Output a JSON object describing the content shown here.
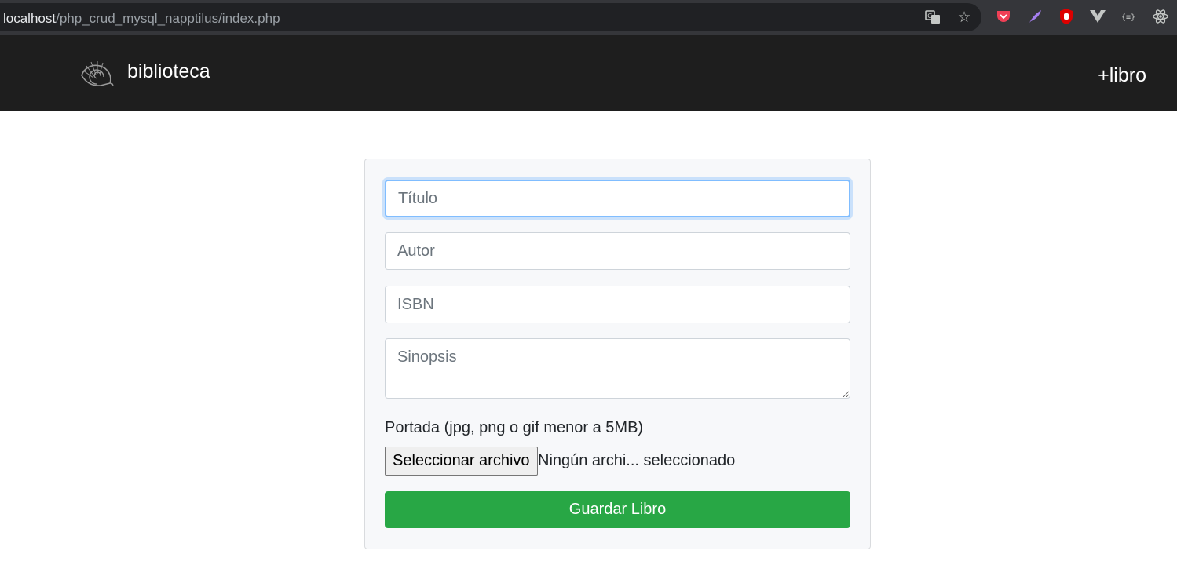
{
  "browser": {
    "url_host": "localhost",
    "url_path": "/php_crud_mysql_napptilus/index.php",
    "icons": [
      "translate-icon",
      "bookmark-star-icon",
      "pocket-extension-icon",
      "feather-extension-icon",
      "ublock-extension-icon",
      "vue-devtools-icon",
      "json-extension-icon",
      "react-devtools-icon"
    ]
  },
  "navbar": {
    "brand": "biblioteca",
    "add_link": "+libro",
    "background": "#1e1e1e"
  },
  "form": {
    "title_placeholder": "Título",
    "author_placeholder": "Autor",
    "isbn_placeholder": "ISBN",
    "synopsis_placeholder": "Sinopsis",
    "cover_label": "Portada (jpg, png o gif menor a 5MB)",
    "file_button": "Seleccionar archivo",
    "file_status": "Ningún archi... seleccionado",
    "submit_label": "Guardar Libro",
    "submit_color": "#28a745"
  }
}
